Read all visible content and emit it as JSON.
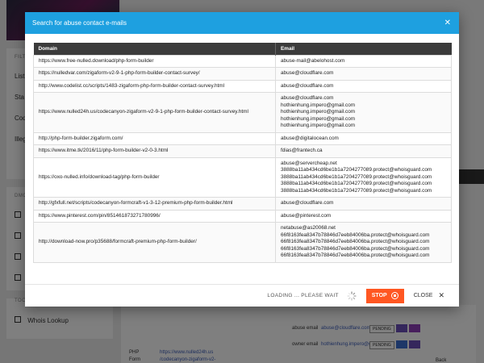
{
  "background": {
    "sidebar": {
      "filters_header": "FILTE",
      "filter_items": [
        "List",
        "Sta",
        "Cod",
        "Illeg"
      ],
      "domains_header": "DMG",
      "tools_header": "TOO",
      "tool_item": "Whois Lookup"
    },
    "detail": {
      "abuse_email_label": "abuse email",
      "abuse_email_value": "abuse@cloudflare.com",
      "owner_email_label": "owner email",
      "owner_email_value": "hothienhung.impero@gmail.com",
      "status_badge": "PENDING",
      "php_label": "PHP",
      "form_label": "Form",
      "php_link": "https://www.nulled24h.us",
      "form_link": "/codecanyon-zigaform-v2-",
      "back_text": "Back"
    }
  },
  "modal": {
    "title": "Search for abuse contact e-mails",
    "columns": [
      "Domain",
      "Email"
    ],
    "rows": [
      {
        "domain": "https://www.free-nulled.download/php-form-builder",
        "emails": [
          "abuse-mail@abelohost.com"
        ]
      },
      {
        "domain": "https://nulledvar.com/zigaform-v2-9-1-php-form-builder-contact-survey/",
        "emails": [
          "abuse@cloudflare.com"
        ]
      },
      {
        "domain": "http://www.codelist.cc/scripts/1483-zigaform-php-form-builder-contact-survey.html",
        "emails": [
          "abuse@cloudflare.com"
        ]
      },
      {
        "domain": "https://www.nulled24h.us/codecanyon-zigaform-v2-9-1-php-form-builder-contact-survey.html",
        "emails": [
          "abuse@cloudflare.com",
          "hothienhung.impero@gmail.com",
          "hothienhung.impero@gmail.com",
          "hothienhung.impero@gmail.com",
          "hothienhung.impero@gmail.com"
        ]
      },
      {
        "domain": "http://php-form-builder.zigaform.com/",
        "emails": [
          "abuse@digitalocean.com"
        ]
      },
      {
        "domain": "https://www.itme.tk/2016/11/php-form-builder-v2-0-3.html",
        "emails": [
          "fdias@frantech.ca"
        ]
      },
      {
        "domain": "https://oxo-nulled.info/download-tag/php-form-builder",
        "emails": [
          "abuse@servercheap.net",
          "3888ba11ab434cd6be1b1a7204277089.protect@whoisguard.com",
          "3888ba11ab434cd6be1b1a7204277089.protect@whoisguard.com",
          "3888ba11ab434cd6be1b1a7204277089.protect@whoisguard.com",
          "3888ba11ab434cd6be1b1a7204277089.protect@whoisguard.com"
        ]
      },
      {
        "domain": "http://gfxfull.net/scripts/codecanyon-formcraft-v1-3-12-premium-php-form-builder.html",
        "emails": [
          "abuse@cloudflare.com"
        ]
      },
      {
        "domain": "https://www.pinterest.com/pin/851461873271780996/",
        "emails": [
          "abuse@pinterest.com"
        ]
      },
      {
        "domain": "http://download-now.pro/p35688/formcraft-premium-php-form-builder/",
        "emails": [
          "netabuse@as20068.net",
          "66f8163fea8347b78846d7eeb84006ba.protect@whoisguard.com",
          "66f8163fea8347b78846d7eeb84006ba.protect@whoisguard.com",
          "66f8163fea8347b78846d7eeb84006ba.protect@whoisguard.com",
          "66f8163fea8347b78846d7eeb84006ba.protect@whoisguard.com"
        ]
      }
    ],
    "footer": {
      "loading_text": "LOADING ... PLEASE WAIT",
      "stop_label": "STOP",
      "close_label": "CLOSE"
    }
  },
  "colors": {
    "header": "#1ea0e0",
    "table_header": "#3b3b3b",
    "stop_button": "#ff5722",
    "link": "#3a5bb8"
  },
  "icons": {
    "modal_close": "close-icon",
    "spinner": "loading-spinner-icon",
    "stop": "stop-circle-icon",
    "close": "close-icon"
  }
}
